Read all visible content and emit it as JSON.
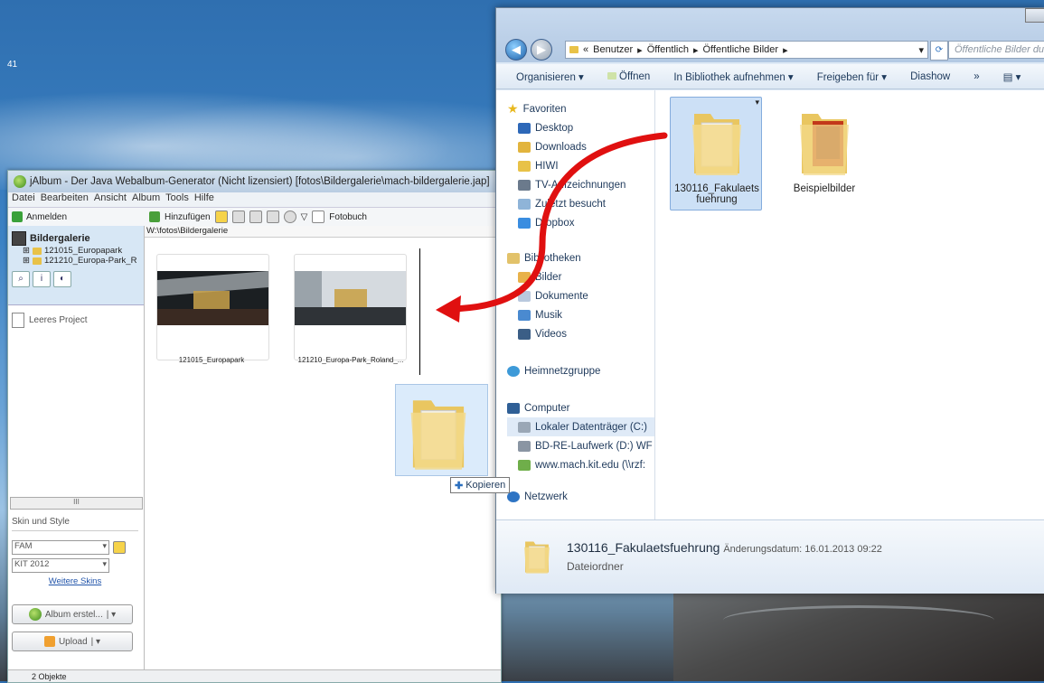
{
  "desktop": {
    "clock_fragment": "41"
  },
  "jalbum": {
    "title": "jAlbum - Der Java Webalbum-Generator (Nicht lizensiert) [fotos\\Bildergalerie\\mach-bildergalerie.jap]",
    "menu": [
      "Datei",
      "Bearbeiten",
      "Ansicht",
      "Album",
      "Tools",
      "Hilfe"
    ],
    "login_label": "Anmelden",
    "toolbar": {
      "add_label": "Hinzufügen",
      "photobook_label": "Fotobuch"
    },
    "path": "W:\\fotos\\Bildergalerie",
    "tree": {
      "root": "Bildergalerie",
      "items": [
        "121015_Europapark",
        "121210_Europa-Park_R"
      ]
    },
    "project_label": "Leeres Project",
    "scroll_label": "III",
    "skin": {
      "section_label": "Skin und Style",
      "skin_value": "FAM",
      "style_value": "KIT 2012",
      "more_link": "Weitere Skins"
    },
    "buttons": {
      "create_label": "Album erstel...",
      "upload_label": "Upload"
    },
    "thumbnails": [
      {
        "label": "121015_Europapark"
      },
      {
        "label": "121210_Europa-Park_Roland_..."
      }
    ],
    "status": "2 Objekte"
  },
  "explorer": {
    "address": {
      "prefix": "«",
      "parts": [
        "Benutzer",
        "Öffentlich",
        "Öffentliche Bilder"
      ]
    },
    "search_placeholder": "Öffentliche Bilder du",
    "commands": [
      "Organisieren ▾",
      "Öffnen",
      "In Bibliothek aufnehmen ▾",
      "Freigeben für ▾",
      "Diashow",
      "»"
    ],
    "nav": {
      "favorites_header": "Favoriten",
      "favorites": [
        "Desktop",
        "Downloads",
        "HIWI",
        "TV-Aufzeichnungen",
        "Zuletzt besucht",
        "Dropbox"
      ],
      "libraries_header": "Bibliotheken",
      "libraries": [
        "Bilder",
        "Dokumente",
        "Musik",
        "Videos"
      ],
      "homegroup": "Heimnetzgruppe",
      "computer_header": "Computer",
      "computer": [
        "Lokaler Datenträger (C:)",
        "BD-RE-Laufwerk (D:) WF",
        "www.mach.kit.edu (\\\\rzf:"
      ],
      "network": "Netzwerk"
    },
    "items": [
      {
        "name": "130116_Fakulaets fuehrung"
      },
      {
        "name": "Beispielbilder"
      }
    ],
    "details": {
      "name": "130116_Fakulaetsfuehrung",
      "meta": "Änderungsdatum: 16.01.2013 09:22",
      "type": "Dateiordner"
    }
  },
  "drag": {
    "tooltip": "Kopieren"
  },
  "colors": {
    "arrow": "#e01010",
    "selection": "#cce0f6"
  }
}
